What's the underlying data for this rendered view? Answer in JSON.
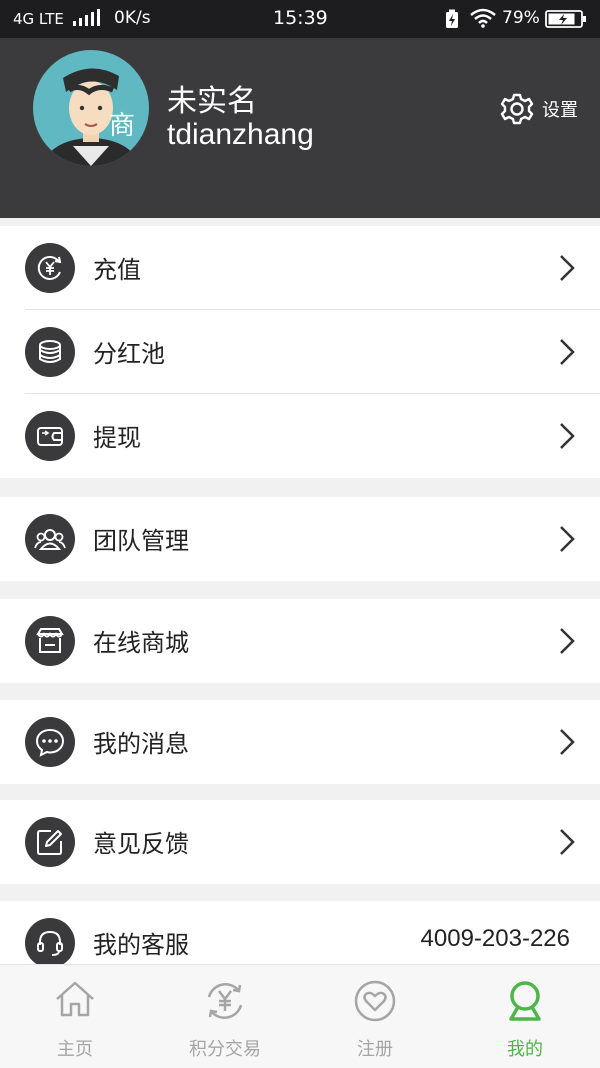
{
  "status_bar": {
    "network": "4G LTE",
    "speed": "0K/s",
    "time": "15:39",
    "battery": "79%"
  },
  "profile": {
    "name": "未实名",
    "username": "tdianzhang",
    "avatar_badge": "商",
    "settings_label": "设置"
  },
  "menu": {
    "recharge": "充值",
    "dividend_pool": "分红池",
    "withdraw": "提现",
    "team_management": "团队管理",
    "online_mall": "在线商城",
    "my_messages": "我的消息",
    "feedback": "意见反馈",
    "customer_service": "我的客服",
    "customer_service_phone": "4009-203-226"
  },
  "tab_bar": {
    "home": "主页",
    "points_trading": "积分交易",
    "register": "注册",
    "mine": "我的",
    "active_color": "#4cb748",
    "inactive_color": "#a5a5a5"
  }
}
